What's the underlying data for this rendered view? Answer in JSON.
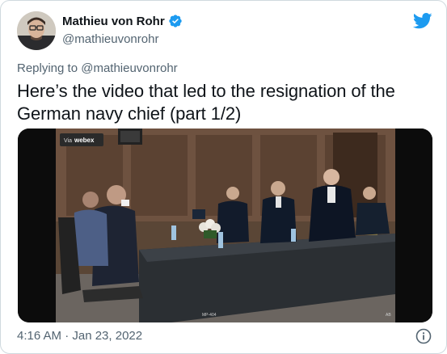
{
  "author": {
    "display_name": "Mathieu von Rohr",
    "handle": "@mathieuvonrohr",
    "verified": true
  },
  "reply": {
    "prefix": "Replying to ",
    "handle": "@mathieuvonrohr"
  },
  "tweet": {
    "text": "Here’s the video that led to the resignation of the German navy chief (part 1/2)",
    "timestamp": "4:16 AM · Jan 23, 2022"
  },
  "media": {
    "webex_badge_prefix": "Via",
    "webex_badge_brand": "webex",
    "tag_left": "MP-404",
    "tag_right": "AB"
  },
  "colors": {
    "brand": "#1d9bf0",
    "text_primary": "#0f1419",
    "text_secondary": "#536471",
    "border": "#cfd9de"
  },
  "icons": {
    "verified": "verified-badge-icon",
    "logo": "twitter-bird-icon",
    "info": "info-icon"
  }
}
